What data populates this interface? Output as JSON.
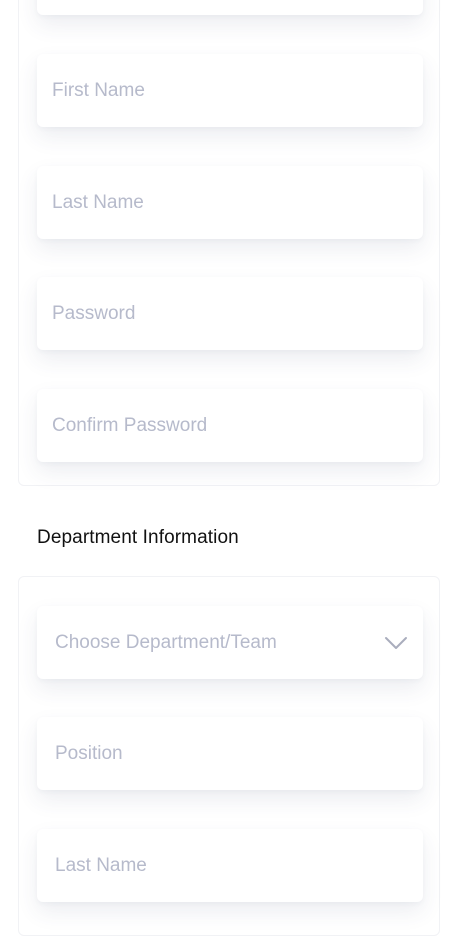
{
  "account": {
    "fields": [
      {
        "placeholder": ""
      },
      {
        "placeholder": "First Name"
      },
      {
        "placeholder": "Last Name"
      },
      {
        "placeholder": "Password"
      },
      {
        "placeholder": "Confirm Password"
      }
    ]
  },
  "department": {
    "title": "Department Information",
    "select": {
      "placeholder": "Choose Department/Team",
      "icon": "chevron-down-icon"
    },
    "fields": [
      {
        "placeholder": "Position"
      },
      {
        "placeholder": "Last Name"
      }
    ]
  },
  "colors": {
    "placeholder": "#b6bacb",
    "heading": "#111111",
    "card_border": "#f1f2f5",
    "chevron": "#a9adbd"
  }
}
